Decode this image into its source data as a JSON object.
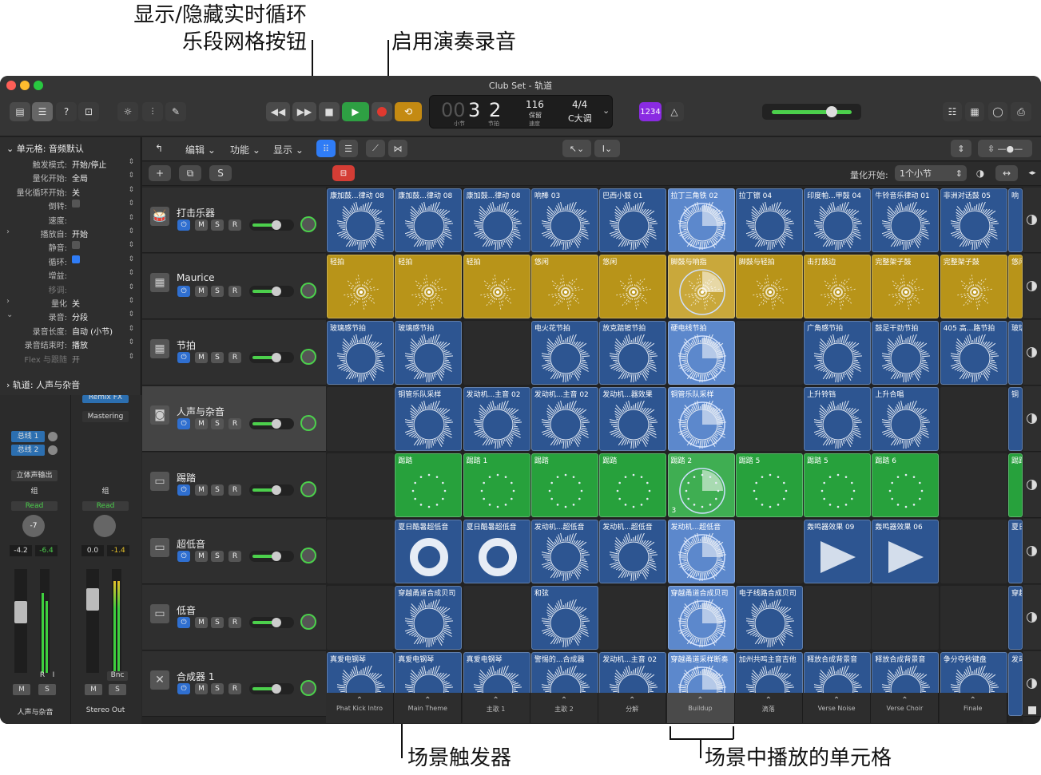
{
  "callouts": {
    "toggle_grid": "显示/隐藏实时循环\n乐段网格按钮",
    "toggle_grid_l1": "显示/隐藏实时循环",
    "toggle_grid_l2": "乐段网格按钮",
    "perf_record": "启用演奏录音",
    "scene_trigger": "场景触发器",
    "playing_cells": "场景中播放的单元格"
  },
  "window": {
    "title": "Club Set - 轨道"
  },
  "lcd": {
    "bar": "3",
    "beat": "2",
    "bar_label": "小节",
    "beat_label": "节拍",
    "tempo": "116",
    "tempo_sub": "保留",
    "tempo_label": "速度",
    "sig": "4/4",
    "key": "C大调",
    "count": "1234",
    "prefix": "00"
  },
  "inspector": {
    "header": "单元格: 音频默认",
    "rows": [
      {
        "k": "触发模式:",
        "v": "开始/停止"
      },
      {
        "k": "量化开始:",
        "v": "全局"
      },
      {
        "k": "量化循环开始:",
        "v": "关"
      },
      {
        "k": "倒转:",
        "v": ""
      },
      {
        "k": "速度:",
        "v": ""
      },
      {
        "k": "播放自:",
        "v": "开始"
      },
      {
        "k": "静音:",
        "v": ""
      },
      {
        "k": "循环:",
        "v": ""
      },
      {
        "k": "增益:",
        "v": ""
      },
      {
        "k": "移调:",
        "v": ""
      },
      {
        "k": "量化",
        "v": "关"
      },
      {
        "k": "录音:",
        "v": "分段"
      },
      {
        "k": "录音长度:",
        "v": "自动 (小节)"
      },
      {
        "k": "录音结束时:",
        "v": "播放"
      },
      {
        "k": "Flex 与跟随",
        "v": "开"
      }
    ],
    "track_header": "轨道: 人声与杂音"
  },
  "toolbar": {
    "edit": "编辑",
    "func": "功能",
    "view": "显示",
    "quant_label": "量化开始:",
    "quant_value": "1个小节",
    "s_btn": "S",
    "plus": "+"
  },
  "tracks": [
    {
      "name": "打击乐器"
    },
    {
      "name": "Maurice"
    },
    {
      "name": "节拍"
    },
    {
      "name": "人声与杂音"
    },
    {
      "name": "踢踏"
    },
    {
      "name": "超低音"
    },
    {
      "name": "低音"
    },
    {
      "name": "合成器 1"
    }
  ],
  "track_btns": {
    "m": "M",
    "s": "S",
    "r": "R"
  },
  "cells": [
    [
      "康加鼓...律动 08",
      "康加鼓...律动 08",
      "康加鼓...律动 08",
      "响棒 03",
      "巴西小鼓 01",
      "拉丁三角铁 02",
      "拉丁镲 04",
      "印度帕...甲鼓 04",
      "牛铃音乐律动 01",
      "非洲对话鼓 05",
      "响"
    ],
    [
      "轻拍",
      "轻拍",
      "轻拍",
      "悠闲",
      "悠闲",
      "脚鼓与响指",
      "脚鼓与轻拍",
      "击打鼓边",
      "完整架子鼓",
      "完整架子鼓",
      "悠闲"
    ],
    [
      "玻璃感节拍",
      "玻璃感节拍",
      "",
      "电火花节拍",
      "放克踏镲节拍",
      "硬电线节拍",
      "",
      "广角感节拍",
      "鼓足干劲节拍",
      "405 高...路节拍",
      "玻璃"
    ],
    [
      "",
      "铜管乐队采样",
      "发动机...主音 02",
      "发动机...主音 02",
      "发动机...器效果",
      "铜管乐队采样",
      "",
      "上升铃铛",
      "上升合唱",
      "",
      "铜"
    ],
    [
      "",
      "踢踏",
      "踢踏 1",
      "踢踏",
      "踢踏",
      "踢踏 2",
      "踢踏 5",
      "踢踏 5",
      "踢踏 6",
      "",
      "踢踏"
    ],
    [
      "",
      "夏日酷暑超低音",
      "夏日酷暑超低音",
      "发动机...超低音",
      "发动机...超低音",
      "发动机...超低音",
      "",
      "轰鸣器效果 09",
      "轰鸣器效果 06",
      "",
      "夏日"
    ],
    [
      "",
      "穿越甬道合成贝司",
      "",
      "和弦",
      "",
      "穿越甬道合成贝司",
      "电子线路合成贝司",
      "",
      "",
      "",
      "穿越"
    ],
    [
      "真爱电钢琴",
      "真爱电钢琴",
      "真爱电钢琴",
      "警惕的...合成器",
      "发动机...主音 02",
      "穿越甬道采样断奏",
      "加州共鸣主音吉他",
      "释放合成背景音",
      "释放合成背景音",
      "争分夺秒键盘",
      "发动"
    ]
  ],
  "cell_badge": "3",
  "scenes": [
    "Phat Kick Intro",
    "Main Theme",
    "主歌 1",
    "主歌 2",
    "分解",
    "Buildup",
    "滴落",
    "Verse Noise",
    "Verse Choir",
    "Finale"
  ],
  "mixer": {
    "strip1": {
      "name": "人声与杂音",
      "bus1": "总线 1",
      "bus2": "总线 2",
      "out": "立体声输出",
      "group": "组",
      "auto": "Read",
      "pan": "-7",
      "vol": "-4.2",
      "peak": "-6.4",
      "r": "R",
      "i": "I",
      "m": "M",
      "s": "S"
    },
    "strip2": {
      "name": "Stereo Out",
      "insert1": "Remix FX",
      "insert2": "Mastering",
      "group": "组",
      "auto": "Read",
      "vol": "0.0",
      "peak": "-1.4",
      "bnc": "Bnc",
      "m": "M",
      "s": "S"
    }
  },
  "colors": {
    "blue": "#2d5591",
    "gold": "#b89419",
    "green": "#27a13c",
    "playing": "#5c88cc",
    "play_btn": "#2ea043",
    "cycle_btn": "#c48a12",
    "rec": "#e0392f"
  }
}
